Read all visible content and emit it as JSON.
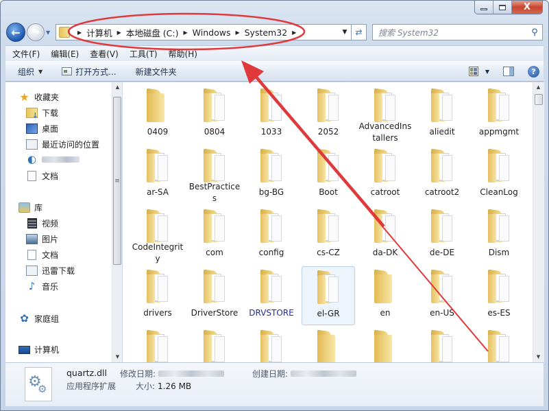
{
  "window": {
    "caption_buttons": {
      "minimize": "minimize",
      "maximize": "maximize",
      "close": "X"
    }
  },
  "nav": {
    "back_icon": "back-arrow-icon",
    "forward_icon": "forward-arrow-icon",
    "breadcrumb": [
      "计算机",
      "本地磁盘 (C:)",
      "Windows",
      "System32"
    ],
    "search_placeholder": "搜索 System32"
  },
  "menu": [
    "文件(F)",
    "编辑(E)",
    "查看(V)",
    "工具(T)",
    "帮助(H)"
  ],
  "toolbar": {
    "organize": "组织",
    "open_with": "打开方式...",
    "new_folder": "新建文件夹"
  },
  "sidebar": {
    "favorites": {
      "label": "收藏夹",
      "items": [
        "下载",
        "桌面",
        "最近访问的位置",
        "",
        "文档"
      ]
    },
    "libraries": {
      "label": "库",
      "items": [
        "视频",
        "图片",
        "文档",
        "迅雷下载",
        "音乐"
      ]
    },
    "homegroup": "家庭组",
    "computer": "计算机"
  },
  "files": [
    [
      "0409",
      "0804",
      "1033",
      "2052",
      "AdvancedInstallers",
      "aliedit",
      "appmgmt"
    ],
    [
      "ar-SA",
      "BestPractices",
      "bg-BG",
      "Boot",
      "catroot",
      "catroot2",
      "CleanLog"
    ],
    [
      "CodeIntegrity",
      "com",
      "config",
      "cs-CZ",
      "da-DK",
      "de-DE",
      "Dism"
    ],
    [
      "drivers",
      "DriverStore",
      "DRVSTORE",
      "el-GR",
      "en",
      "en-US",
      "es-ES"
    ]
  ],
  "selected_file": "el-GR",
  "encrypted_file": "DRVSTORE",
  "details": {
    "name": "quartz.dll",
    "type": "应用程序扩展",
    "modified_label": "修改日期:",
    "size_label": "大小:",
    "size_value": "1.26 MB",
    "created_label": "创建日期:"
  },
  "colors": {
    "annotation_red": "#e0393b",
    "encrypted_text": "#2a2d8f",
    "selection_bg": "#eef4fb"
  }
}
